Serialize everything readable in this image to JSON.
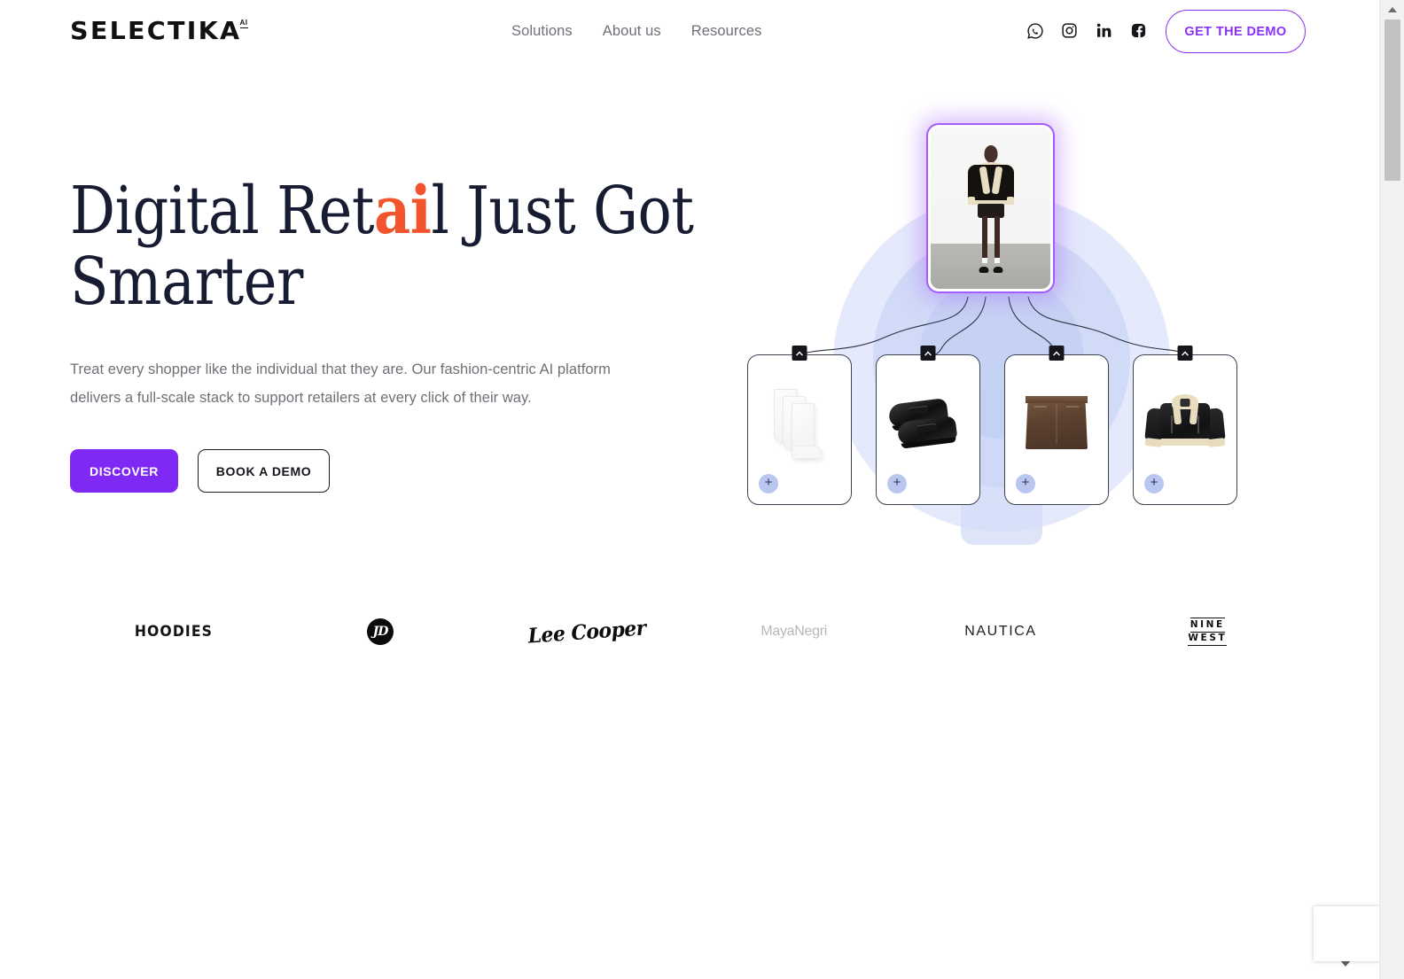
{
  "header": {
    "brand_word": "SELECTIKA",
    "brand_sup": "AI",
    "nav": [
      {
        "label": "Solutions"
      },
      {
        "label": "About us"
      },
      {
        "label": "Resources"
      }
    ],
    "social": [
      {
        "name": "whatsapp-icon",
        "title": "WhatsApp"
      },
      {
        "name": "instagram-icon",
        "title": "Instagram"
      },
      {
        "name": "linkedin-icon",
        "title": "LinkedIn"
      },
      {
        "name": "facebook-icon",
        "title": "Facebook"
      }
    ],
    "cta_label": "GET THE DEMO"
  },
  "hero": {
    "title_part1": "Digital Ret",
    "title_accent": "ai",
    "title_part2": "l Just Got",
    "title_line2": "Smarter",
    "subtitle": "Treat every shopper like the individual that they are. Our fashion-centric AI platform delivers a full-scale stack to support retailers at every click of their way.",
    "primary_button": "DISCOVER",
    "secondary_button": "BOOK A DEMO"
  },
  "visual": {
    "model_card_alt": "Model wearing black shearling jacket, leather mini skirt, tights, white socks and black loafers",
    "products": [
      {
        "name": "white-socks",
        "alt": "White folded socks",
        "plus_label": "+"
      },
      {
        "name": "black-loafers",
        "alt": "Black patent penny loafers",
        "plus_label": "+"
      },
      {
        "name": "brown-leather-skirt",
        "alt": "Brown leather mini skirt",
        "plus_label": "+"
      },
      {
        "name": "shearling-jacket",
        "alt": "Black shearling aviator jacket with cream trim",
        "plus_label": "+"
      }
    ]
  },
  "brands": [
    {
      "name": "hoodies",
      "label": "HOODIES"
    },
    {
      "name": "jd",
      "label": "JD"
    },
    {
      "name": "lee-cooper",
      "label": "Lee Cooper"
    },
    {
      "name": "maya-negri",
      "label": "MayaNegri"
    },
    {
      "name": "nautica",
      "label": "NAUTICA"
    },
    {
      "name": "nine-west",
      "label_line1": "NINE",
      "label_line2": "WEST"
    }
  ],
  "colors": {
    "accent_purple": "#7f29f5",
    "outline_purple": "#8b31f7",
    "accent_orange": "#f2552e",
    "heading_navy": "#181c32",
    "body_grey": "#6d7076",
    "glow_blue": "#ccd6f6",
    "plus_blue": "#b9c6ef"
  }
}
